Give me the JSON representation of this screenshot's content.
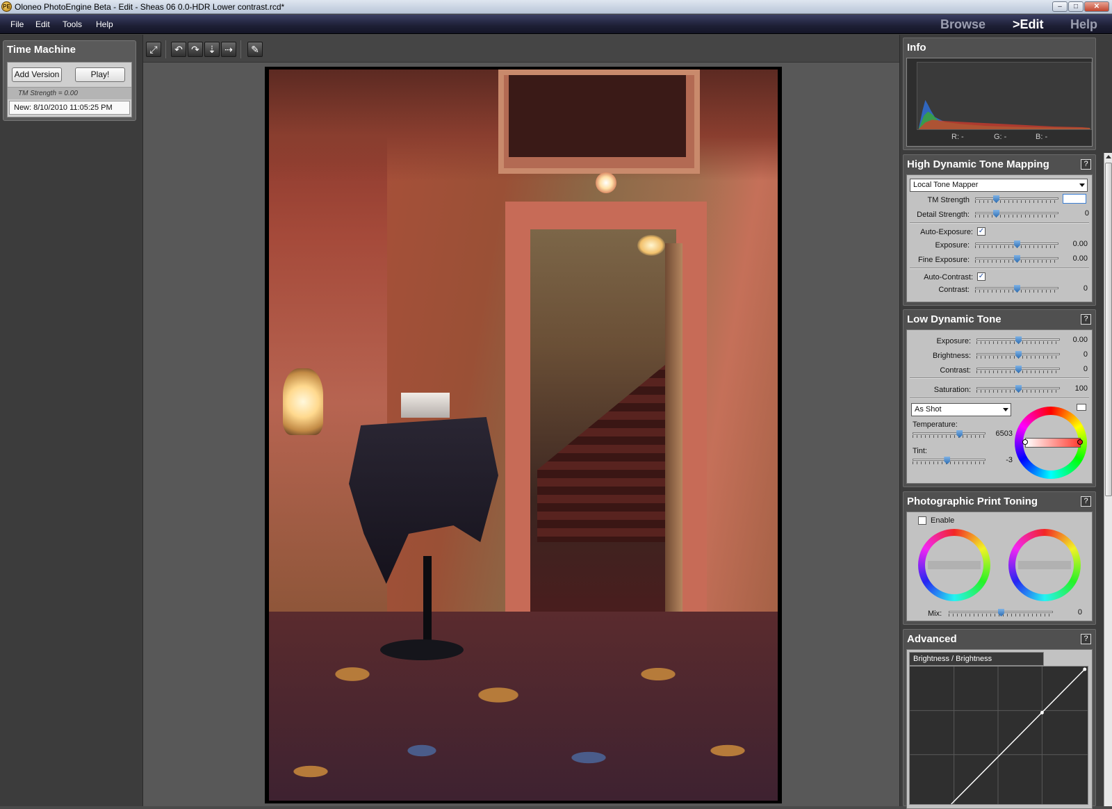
{
  "window": {
    "title": "Oloneo PhotoEngine Beta - Edit - Sheas 06  0.0-HDR Lower contrast.rcd*",
    "app_icon": "PE",
    "minimize": "–",
    "maximize": "□",
    "close": "✕"
  },
  "menu": {
    "items": [
      "File",
      "Edit",
      "Tools",
      "Help"
    ]
  },
  "modes": {
    "browse": "Browse",
    "edit": ">Edit",
    "help": "Help",
    "active": "edit"
  },
  "time_machine": {
    "title": "Time Machine",
    "add_version": "Add Version",
    "play": "Play!",
    "strength_note": "TM Strength = 0.00",
    "version_entry": "New: 8/10/2010 11:05:25 PM"
  },
  "toolbar": {
    "icons": [
      "fit-to-window-icon",
      "rotate-left-icon",
      "rotate-right-icon",
      "flip-vertical-icon",
      "flip-horizontal-icon",
      "eyedropper-icon"
    ]
  },
  "info": {
    "title": "Info",
    "r_label": "R: -",
    "g_label": "G: -",
    "b_label": "B: -"
  },
  "hdr": {
    "title": "High Dynamic Tone Mapping",
    "help": "?",
    "mapper": "Local Tone Mapper",
    "tm_strength_label": "TM Strength",
    "tm_strength_value": "",
    "detail_strength_label": "Detail Strength:",
    "detail_strength_value": "0",
    "auto_exposure_label": "Auto-Exposure:",
    "auto_exposure_checked": true,
    "exposure_label": "Exposure:",
    "exposure_value": "0.00",
    "fine_exposure_label": "Fine Exposure:",
    "fine_exposure_value": "0.00",
    "auto_contrast_label": "Auto-Contrast:",
    "auto_contrast_checked": true,
    "contrast_label": "Contrast:",
    "contrast_value": "0"
  },
  "ldt": {
    "title": "Low Dynamic Tone",
    "help": "?",
    "exposure_label": "Exposure:",
    "exposure_value": "0.00",
    "brightness_label": "Brightness:",
    "brightness_value": "0",
    "contrast_label": "Contrast:",
    "contrast_value": "0",
    "saturation_label": "Saturation:",
    "saturation_value": "100",
    "white_balance": "As Shot",
    "temperature_label": "Temperature:",
    "temperature_value": "6503",
    "tint_label": "Tint:",
    "tint_value": "-3"
  },
  "ppt": {
    "title": "Photographic Print Toning",
    "help": "?",
    "enable_label": "Enable",
    "enable_checked": false,
    "mix_label": "Mix:",
    "mix_value": "0"
  },
  "advanced": {
    "title": "Advanced",
    "help": "?",
    "curve_tab": "Brightness / Brightness"
  }
}
